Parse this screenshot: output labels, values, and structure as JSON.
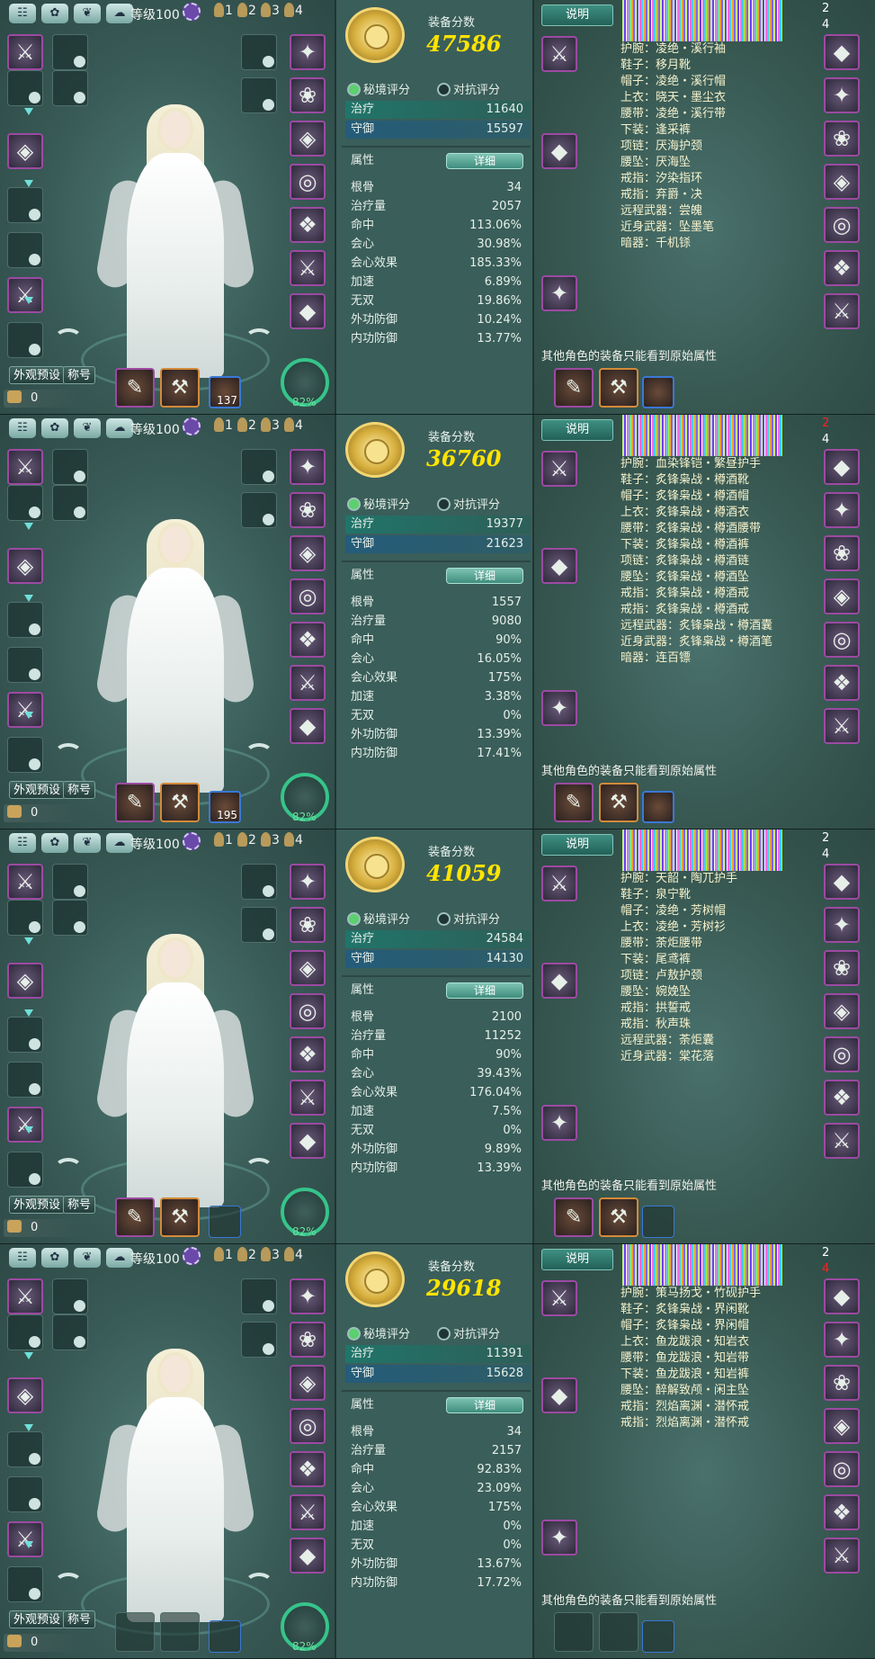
{
  "labels": {
    "level": "等级100",
    "score_label": "装备分数",
    "tab_secret": "秘境评分",
    "tab_versus": "对抗评分",
    "heal_label": "治疗",
    "defense_label": "守御",
    "attr_header": "属性",
    "detail_button": "详细",
    "preset_button": "外观预设",
    "title_button": "称号",
    "coins": "0",
    "explain_button": "说明",
    "note": "其他角色的装备只能看到原始属性",
    "players": [
      "1",
      "2",
      "3",
      "4"
    ],
    "stat_names": [
      "根骨",
      "治疗量",
      "命中",
      "会心",
      "会心效果",
      "加速",
      "无双",
      "外功防御",
      "内功防御"
    ]
  },
  "panels": [
    {
      "score": "47586",
      "heal": "11640",
      "defense": "15597",
      "stats": [
        "34",
        "2057",
        "113.06%",
        "30.98%",
        "185.33%",
        "6.89%",
        "19.86%",
        "10.24%",
        "13.77%"
      ],
      "bag_count": "137",
      "gauge": "82%",
      "side_numbers": [
        "2",
        "4"
      ],
      "side_red": "",
      "equipment": [
        "护腕：凌绝・溪行袖",
        "鞋子：移月靴",
        "帽子：凌绝・溪行帽",
        "上衣：晓天・墨尘衣",
        "腰带：凌绝・溪行带",
        "下装：逢采裤",
        "项链：厌海护颈",
        "腰坠：厌海坠",
        "戒指：汐染指环",
        "戒指：弃爵・决",
        "远程武器：尝魄",
        "近身武器：坠墨笔",
        "暗器：千机铩"
      ]
    },
    {
      "score": "36760",
      "heal": "19377",
      "defense": "21623",
      "stats": [
        "1557",
        "9080",
        "90%",
        "16.05%",
        "175%",
        "3.38%",
        "0%",
        "13.39%",
        "17.41%"
      ],
      "bag_count": "195",
      "gauge": "82%",
      "side_numbers": [
        "2",
        "4"
      ],
      "side_red": "first",
      "equipment": [
        "护腕：血染锋铠・繁昼护手",
        "鞋子：炙锋枭战・樽酒靴",
        "帽子：炙锋枭战・樽酒帽",
        "上衣：炙锋枭战・樽酒衣",
        "腰带：炙锋枭战・樽酒腰带",
        "下装：炙锋枭战・樽酒裤",
        "项链：炙锋枭战・樽酒链",
        "腰坠：炙锋枭战・樽酒坠",
        "戒指：炙锋枭战・樽酒戒",
        "戒指：炙锋枭战・樽酒戒",
        "远程武器：炙锋枭战・樽酒囊",
        "近身武器：炙锋枭战・樽酒笔",
        "暗器：连百镖"
      ]
    },
    {
      "score": "41059",
      "heal": "24584",
      "defense": "14130",
      "stats": [
        "2100",
        "11252",
        "90%",
        "39.43%",
        "176.04%",
        "7.5%",
        "0%",
        "9.89%",
        "13.39%"
      ],
      "bag_count": "",
      "gauge": "82%",
      "side_numbers": [
        "2",
        "4"
      ],
      "side_red": "",
      "equipment": [
        "护腕：天韶・陶兀护手",
        "鞋子：泉宁靴",
        "帽子：凌绝・芳树帽",
        "上衣：凌绝・芳树衫",
        "腰带：荼炬腰带",
        "下装：尾鸢裤",
        "项链：卢敖护颈",
        "腰坠：婉娩坠",
        "戒指：拱誓戒",
        "戒指：秋声珠",
        "远程武器：荼炬囊",
        "近身武器：棠花落"
      ]
    },
    {
      "score": "29618",
      "heal": "11391",
      "defense": "15628",
      "stats": [
        "34",
        "2157",
        "92.83%",
        "23.09%",
        "175%",
        "0%",
        "0%",
        "13.67%",
        "17.72%"
      ],
      "bag_count": "",
      "gauge": "82%",
      "side_numbers": [
        "2",
        "4"
      ],
      "side_red": "second",
      "equipment": [
        "护腕：策马扬戈・竹砚护手",
        "鞋子：炙锋枭战・界闲靴",
        "帽子：炙锋枭战・界闲帽",
        "上衣：鱼龙跋浪・知岩衣",
        "腰带：鱼龙跋浪・知岩带",
        "下装：鱼龙跋浪・知岩裤",
        "腰坠：醉解致颅・闲主坠",
        "戒指：烈焰离渊・潜怀戒",
        "戒指：烈焰离渊・潜怀戒"
      ]
    }
  ],
  "icons": {
    "top_bar": [
      "wardrobe-icon",
      "leaf-icon",
      "flower-icon",
      "cloud-icon"
    ],
    "accent_gold": "#ffe400",
    "accent_green": "#36c48a"
  }
}
